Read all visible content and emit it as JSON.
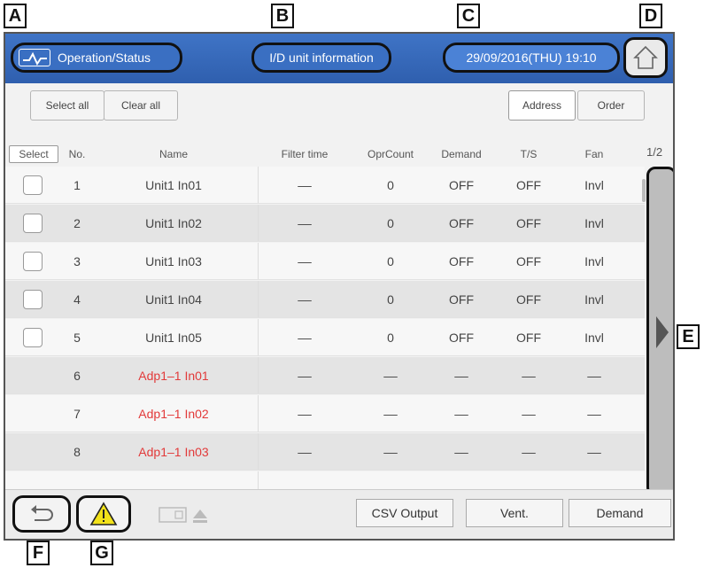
{
  "callouts": {
    "a": "A",
    "b": "B",
    "c": "C",
    "d": "D",
    "e": "E",
    "f": "F",
    "g": "G"
  },
  "header": {
    "section_title": "Operation/Status",
    "screen_title": "I/D unit information",
    "datetime": "29/09/2016(THU) 19:10",
    "icons": {
      "status": "pulse-icon",
      "home": "home-icon"
    }
  },
  "toolbar": {
    "select_all": "Select all",
    "clear_all": "Clear all",
    "address": "Address",
    "order": "Order"
  },
  "table": {
    "columns": {
      "select": "Select",
      "no": "No.",
      "name": "Name",
      "filter_time": "Filter time",
      "opr_count": "OprCount",
      "demand": "Demand",
      "ts": "T/S",
      "fan": "Fan"
    },
    "page_indicator": "1/2",
    "rows": [
      {
        "no": "1",
        "name": "Unit1 In01",
        "filter": "––",
        "opr": "0",
        "demand": "OFF",
        "ts": "OFF",
        "fan": "Invl"
      },
      {
        "no": "2",
        "name": "Unit1 In02",
        "filter": "––",
        "opr": "0",
        "demand": "OFF",
        "ts": "OFF",
        "fan": "Invl"
      },
      {
        "no": "3",
        "name": "Unit1 In03",
        "filter": "––",
        "opr": "0",
        "demand": "OFF",
        "ts": "OFF",
        "fan": "Invl"
      },
      {
        "no": "4",
        "name": "Unit1 In04",
        "filter": "––",
        "opr": "0",
        "demand": "OFF",
        "ts": "OFF",
        "fan": "Invl"
      },
      {
        "no": "5",
        "name": "Unit1 In05",
        "filter": "––",
        "opr": "0",
        "demand": "OFF",
        "ts": "OFF",
        "fan": "Invl"
      },
      {
        "no": "6",
        "name": "Adp1–1 In01",
        "filter": "––",
        "opr": "––",
        "demand": "––",
        "ts": "––",
        "fan": "––"
      },
      {
        "no": "7",
        "name": "Adp1–1 In02",
        "filter": "––",
        "opr": "––",
        "demand": "––",
        "ts": "––",
        "fan": "––"
      },
      {
        "no": "8",
        "name": "Adp1–1 In03",
        "filter": "––",
        "opr": "––",
        "demand": "––",
        "ts": "––",
        "fan": "––"
      }
    ]
  },
  "footer": {
    "csv_output": "CSV Output",
    "vent": "Vent.",
    "demand": "Demand",
    "icons": {
      "back": "back-arrow-icon",
      "warning": "warning-icon",
      "sd_eject": "sd-card-eject-icon",
      "next": "next-page-icon"
    }
  },
  "colors": {
    "header_blue": "#3a6fc2",
    "adapter_name_red": "#e23a3a",
    "warning_yellow": "#f2e21a"
  }
}
